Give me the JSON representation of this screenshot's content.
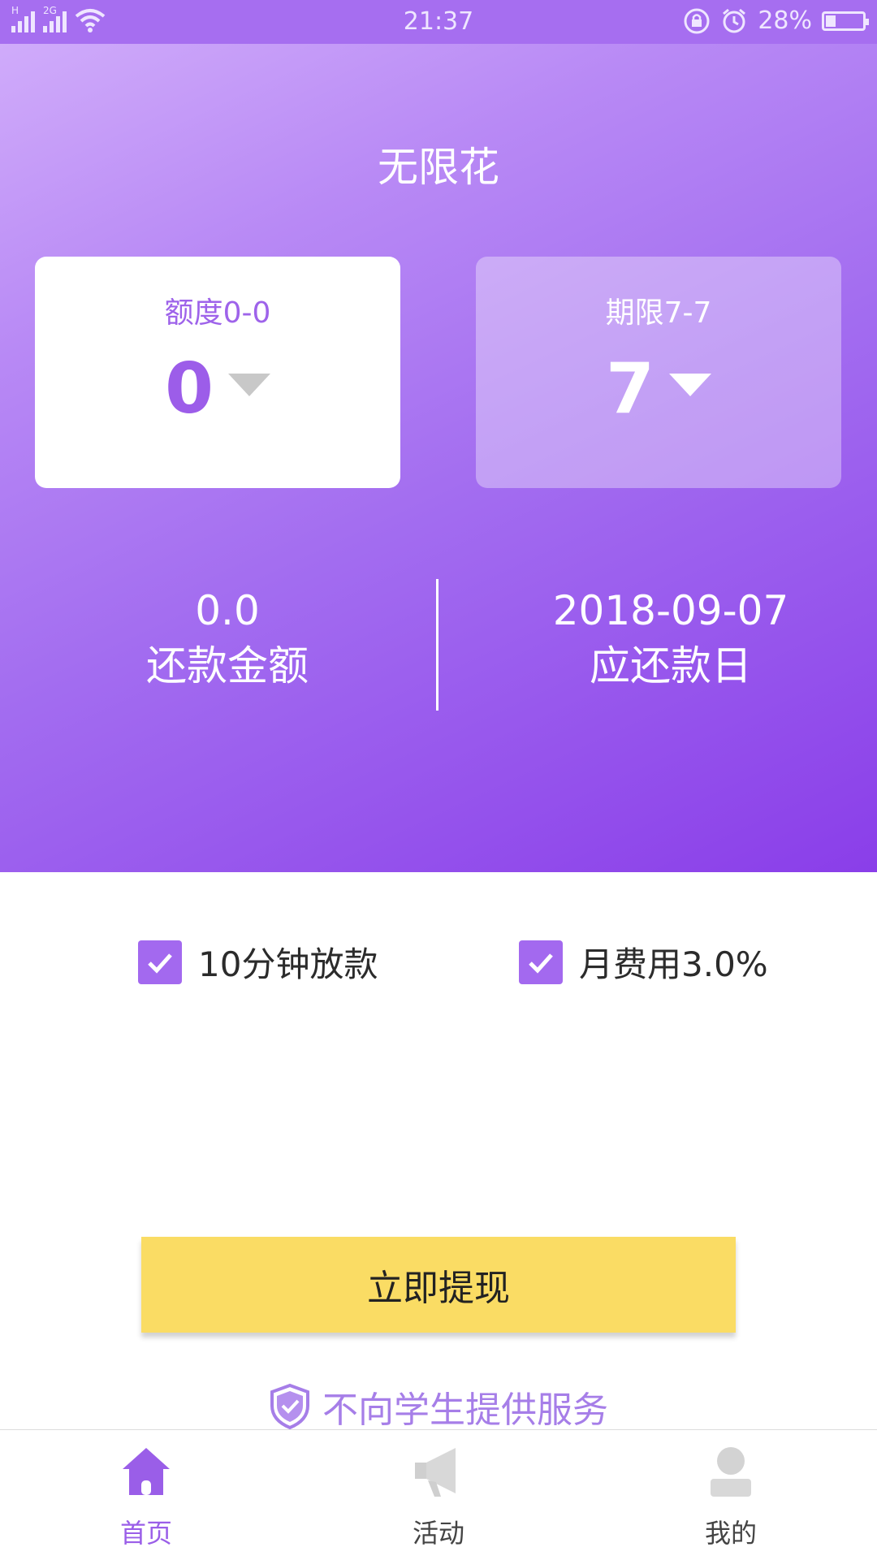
{
  "status_bar": {
    "time": "21:37",
    "battery": "28%",
    "battery_level": 0.28,
    "network_left": "H",
    "network_right": "2G"
  },
  "header": {
    "title": "无限花"
  },
  "amount_card": {
    "label": "额度0-0",
    "value": "0"
  },
  "term_card": {
    "label": "期限7-7",
    "value": "7"
  },
  "summary": {
    "repay_amount_value": "0.0",
    "repay_amount_label": "还款金额",
    "due_date_value": "2018-09-07",
    "due_date_label": "应还款日"
  },
  "features": [
    {
      "label": "10分钟放款",
      "checked": true
    },
    {
      "label": "月费用3.0%",
      "checked": true
    }
  ],
  "cta_button": {
    "label": "立即提现"
  },
  "notice": {
    "text": "不向学生提供服务",
    "icon": "shield-check-icon"
  },
  "tabs": [
    {
      "label": "首页",
      "icon": "home-icon",
      "active": true
    },
    {
      "label": "活动",
      "icon": "megaphone-icon",
      "active": false
    },
    {
      "label": "我的",
      "icon": "user-icon",
      "active": false
    }
  ],
  "colors": {
    "accent": "#9c5de9",
    "button": "#fadc64",
    "gradient_start": "#d3b0fb",
    "gradient_end": "#8a3ee9"
  }
}
